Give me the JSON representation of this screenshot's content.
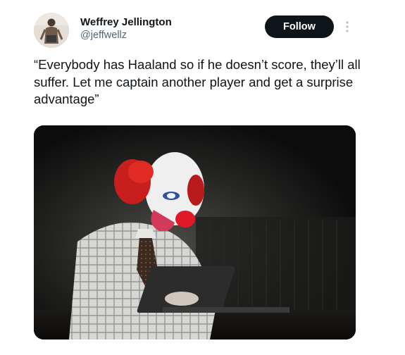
{
  "author": {
    "display_name": "Weffrey Jellington",
    "handle": "@jeffwellz"
  },
  "actions": {
    "follow_label": "Follow",
    "more_icon": "more-vertical-icon"
  },
  "tweet": {
    "text": "“Everybody has Haaland so if he doesn’t score, they’ll all suffer. Let me captain another player and get a surprise advantage”"
  },
  "colors": {
    "text_primary": "#0f1419",
    "text_secondary": "#536471",
    "follow_button_bg": "#0f1419",
    "follow_button_text": "#ffffff"
  }
}
